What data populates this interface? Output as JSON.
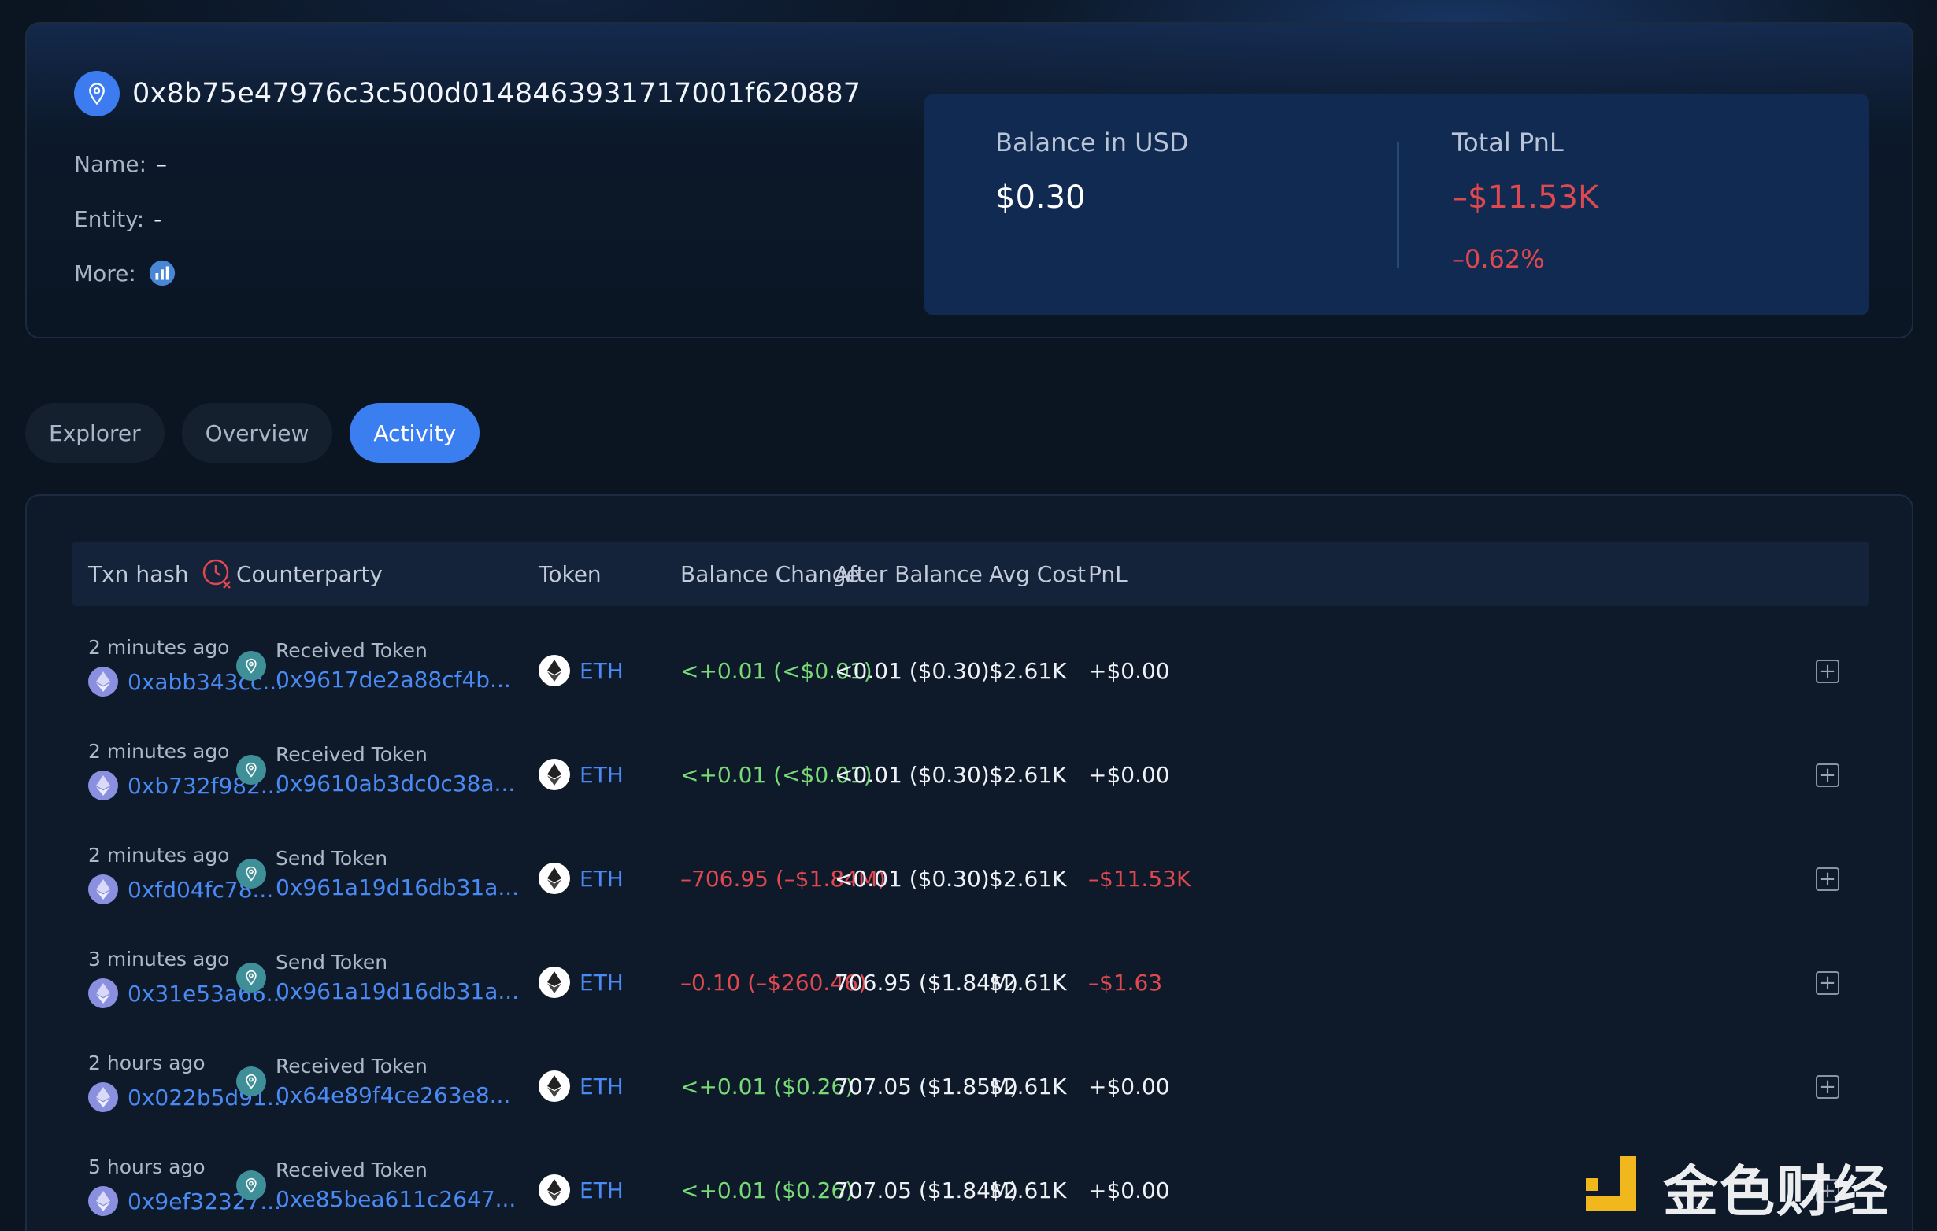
{
  "header": {
    "address": "0x8b75e47976c3c500d0148463931717001f620887",
    "name_label": "Name:",
    "name_value": "–",
    "entity_label": "Entity:",
    "entity_value": "-",
    "more_label": "More:"
  },
  "balance": {
    "usd_label": "Balance in USD",
    "usd_value": "$0.30",
    "pnl_label": "Total PnL",
    "pnl_value": "–$11.53K",
    "pnl_percent": "–0.62%"
  },
  "tabs": [
    {
      "label": "Explorer",
      "active": false
    },
    {
      "label": "Overview",
      "active": false
    },
    {
      "label": "Activity",
      "active": true
    }
  ],
  "table": {
    "headers": {
      "txn_hash": "Txn hash",
      "counterparty": "Counterparty",
      "token": "Token",
      "balance_change": "Balance Change",
      "after_balance": "After Balance",
      "avg_cost": "Avg Cost",
      "pnl": "PnL"
    },
    "rows": [
      {
        "time": "2 minutes ago",
        "hash": "0xabb343cc...",
        "cp_type": "Received Token",
        "cp_addr": "0x9617de2a88cf4b...",
        "token": "ETH",
        "change": "<+0.01 (<$0.01)",
        "after": "<0.01 ($0.30)",
        "avg": "$2.61K",
        "pnl": "+$0.00"
      },
      {
        "time": "2 minutes ago",
        "hash": "0xb732f982...",
        "cp_type": "Received Token",
        "cp_addr": "0x9610ab3dc0c38a...",
        "token": "ETH",
        "change": "<+0.01 (<$0.01)",
        "after": "<0.01 ($0.30)",
        "avg": "$2.61K",
        "pnl": "+$0.00"
      },
      {
        "time": "2 minutes ago",
        "hash": "0xfd04fc78...",
        "cp_type": "Send Token",
        "cp_addr": "0x961a19d16db31a...",
        "token": "ETH",
        "change": "–706.95 (–$1.84M)",
        "after": "<0.01 ($0.30)",
        "avg": "$2.61K",
        "pnl": "–$11.53K"
      },
      {
        "time": "3 minutes ago",
        "hash": "0x31e53a66...",
        "cp_type": "Send Token",
        "cp_addr": "0x961a19d16db31a...",
        "token": "ETH",
        "change": "–0.10 (–$260.46)",
        "after": "706.95 ($1.84M)",
        "avg": "$2.61K",
        "pnl": "–$1.63"
      },
      {
        "time": "2 hours ago",
        "hash": "0x022b5d91...",
        "cp_type": "Received Token",
        "cp_addr": "0x64e89f4ce263e8...",
        "token": "ETH",
        "change": "<+0.01 ($0.26)",
        "after": "707.05 ($1.85M)",
        "avg": "$2.61K",
        "pnl": "+$0.00"
      },
      {
        "time": "5 hours ago",
        "hash": "0x9ef32327...",
        "cp_type": "Received Token",
        "cp_addr": "0xe85bea611c2647...",
        "token": "ETH",
        "change": "<+0.01 ($0.26)",
        "after": "707.05 ($1.84M)",
        "avg": "$2.61K",
        "pnl": "+$0.00"
      }
    ]
  },
  "watermark": {
    "text": "金色财经"
  },
  "colors": {
    "accent": "#3a7ef0",
    "positive": "#78d977",
    "negative": "#e0484f",
    "link": "#4a8af4"
  }
}
